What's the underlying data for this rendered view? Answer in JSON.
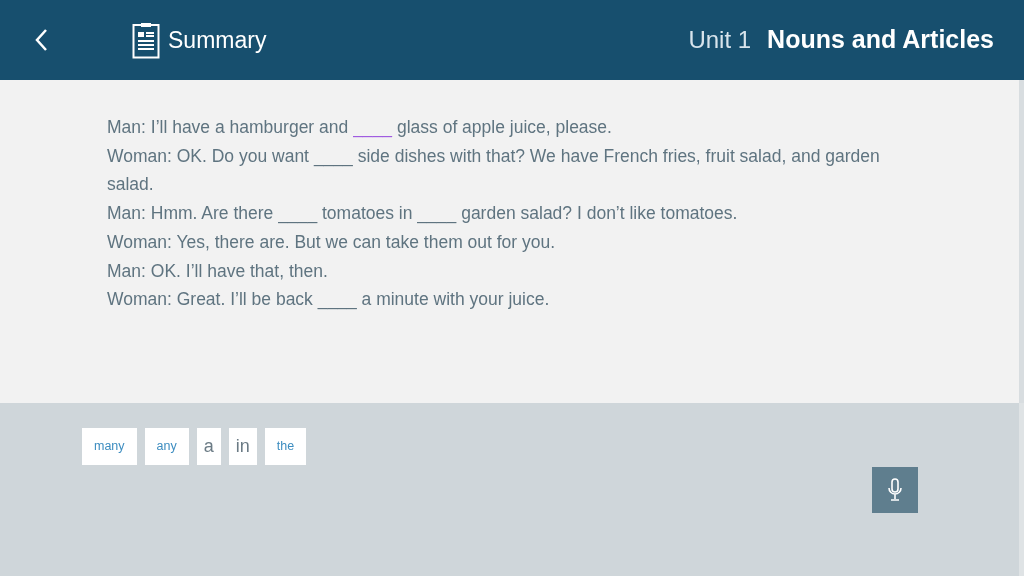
{
  "header": {
    "title": "Summary",
    "unit": "Unit 1",
    "lesson": "Nouns and Articles"
  },
  "dialog": [
    {
      "segments": [
        {
          "kind": "text",
          "text": "Man: I’ll have a hamburger and"
        },
        {
          "kind": "blank",
          "text": "____",
          "selected": true
        },
        {
          "kind": "text",
          "text": "glass of apple juice, please."
        }
      ]
    },
    {
      "segments": [
        {
          "kind": "text",
          "text": "Woman: OK. Do you want"
        },
        {
          "kind": "blank",
          "text": "____",
          "selected": false
        },
        {
          "kind": "text",
          "text": "side dishes with that? We have French fries, fruit salad, and garden"
        },
        {
          "kind": "text",
          "text": "salad."
        }
      ]
    },
    {
      "segments": [
        {
          "kind": "text",
          "text": "Man: Hmm. Are there"
        },
        {
          "kind": "blank",
          "text": "____",
          "selected": false
        },
        {
          "kind": "text",
          "text": "tomatoes in"
        },
        {
          "kind": "blank",
          "text": "____",
          "selected": false
        },
        {
          "kind": "text",
          "text": "garden salad? I don’t like tomatoes."
        }
      ]
    },
    {
      "segments": [
        {
          "kind": "text",
          "text": "Woman: Yes, there are. But we can take them out for you."
        }
      ]
    },
    {
      "segments": [
        {
          "kind": "text",
          "text": "Man: OK. I’ll have that, then."
        }
      ]
    },
    {
      "segments": [
        {
          "kind": "text",
          "text": "Woman: Great. I’ll be back"
        },
        {
          "kind": "blank",
          "text": "____",
          "selected": false
        },
        {
          "kind": "text",
          "text": "a minute with your juice."
        }
      ]
    }
  ],
  "word_bank": [
    {
      "text": "many",
      "kind": "small"
    },
    {
      "text": "any",
      "kind": "small"
    },
    {
      "text": "a",
      "kind": "large"
    },
    {
      "text": "in",
      "kind": "large"
    },
    {
      "text": "the",
      "kind": "small"
    }
  ]
}
